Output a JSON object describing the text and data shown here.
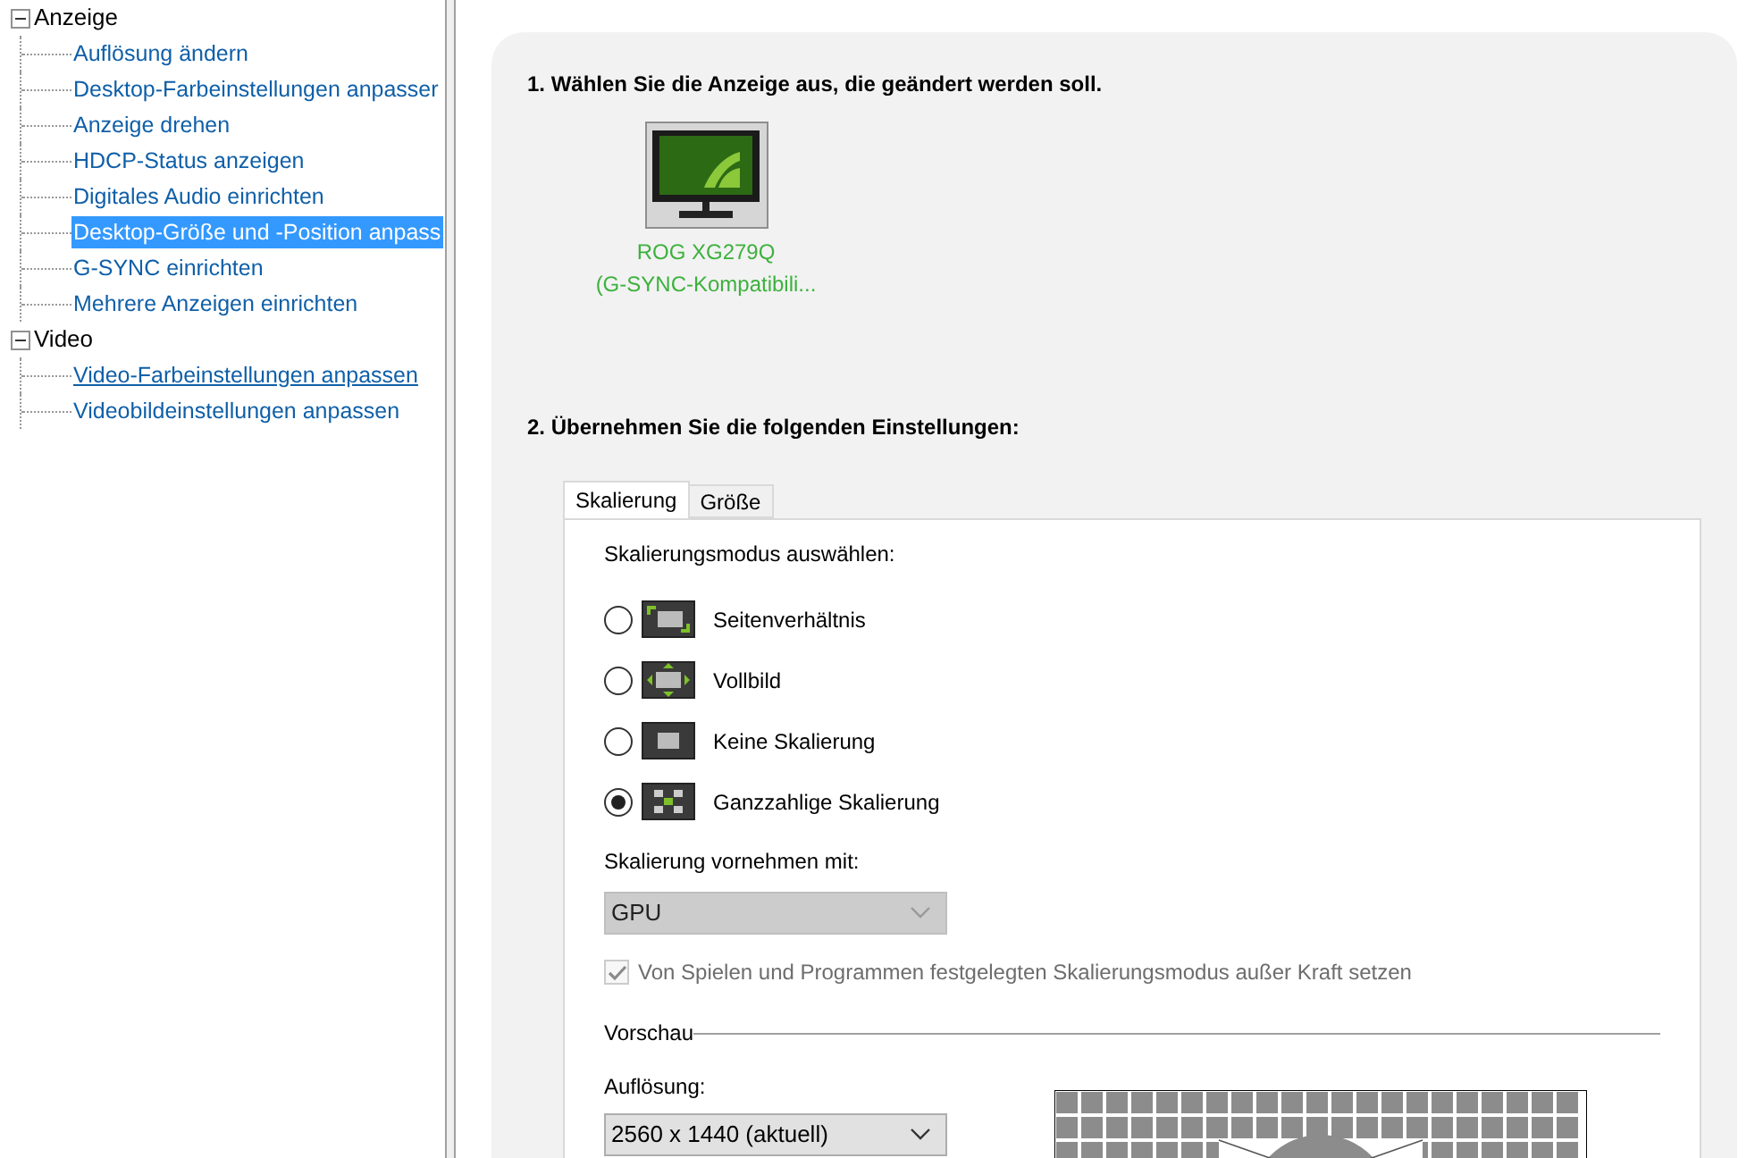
{
  "tree": [
    {
      "label": "Anzeige",
      "expanded": true,
      "children": [
        {
          "label": "Auflösung ändern",
          "selected": false,
          "hovered": false
        },
        {
          "label": "Desktop-Farbeinstellungen anpasser",
          "selected": false,
          "hovered": false
        },
        {
          "label": "Anzeige drehen",
          "selected": false,
          "hovered": false
        },
        {
          "label": "HDCP-Status anzeigen",
          "selected": false,
          "hovered": false
        },
        {
          "label": "Digitales Audio einrichten",
          "selected": false,
          "hovered": false
        },
        {
          "label": "Desktop-Größe und -Position anpass",
          "selected": true,
          "hovered": false
        },
        {
          "label": "G-SYNC einrichten",
          "selected": false,
          "hovered": false
        },
        {
          "label": "Mehrere Anzeigen einrichten",
          "selected": false,
          "hovered": false
        }
      ]
    },
    {
      "label": "Video",
      "expanded": true,
      "children": [
        {
          "label": "Video-Farbeinstellungen anpassen",
          "selected": false,
          "hovered": true
        },
        {
          "label": "Videobildeinstellungen anpassen",
          "selected": false,
          "hovered": false
        }
      ]
    }
  ],
  "step1": {
    "heading": "1. Wählen Sie die Anzeige aus, die geändert werden soll.",
    "display": {
      "name": "ROG XG279Q",
      "subtitle": "(G-SYNC-Kompatibili...",
      "selected": true
    }
  },
  "step2": {
    "heading": "2. Übernehmen Sie die folgenden Einstellungen:",
    "tabs": [
      {
        "label": "Skalierung",
        "selected": true
      },
      {
        "label": "Größe",
        "selected": false
      }
    ],
    "mode_label": "Skalierungsmodus auswählen:",
    "modes": [
      {
        "kind": "aspect",
        "label": "Seitenverhältnis",
        "selected": false
      },
      {
        "kind": "full",
        "label": "Vollbild",
        "selected": false
      },
      {
        "kind": "none",
        "label": "Keine Skalierung",
        "selected": false
      },
      {
        "kind": "integer",
        "label": "Ganzzahlige Skalierung",
        "selected": true
      }
    ],
    "perform_label": "Skalierung vornehmen mit:",
    "perform_select": {
      "value": "GPU",
      "disabled": true
    },
    "override": {
      "label": "Von Spielen und Programmen festgelegten Skalierungsmodus außer Kraft setzen",
      "checked": true,
      "disabled": true
    },
    "preview": {
      "legend": "Vorschau",
      "resolution_label": "Auflösung:",
      "resolution_select": {
        "value": "2560 x 1440 (aktuell)",
        "disabled": false
      }
    }
  }
}
